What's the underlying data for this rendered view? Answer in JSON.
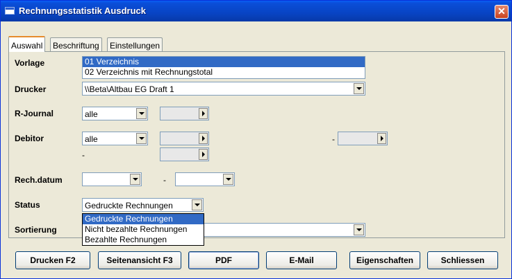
{
  "window": {
    "title": "Rechnungsstatistik Ausdruck",
    "close_label": "✕"
  },
  "tabs": [
    "Auswahl",
    "Beschriftung",
    "Einstellungen"
  ],
  "form": {
    "vorlage": {
      "label": "Vorlage",
      "items": [
        "01 Verzeichnis",
        "02 Verzeichnis mit Rechnungstotal"
      ],
      "selected_index": 0
    },
    "drucker": {
      "label": "Drucker",
      "value": "\\\\Beta\\Altbau EG Draft 1"
    },
    "rjournal": {
      "label": "R-Journal",
      "value": "alle"
    },
    "debitor": {
      "label": "Debitor",
      "value": "alle",
      "range_dash": "-",
      "below_dash": "-"
    },
    "rechdatum": {
      "label": "Rech.datum",
      "dash": "-"
    },
    "status": {
      "label": "Status",
      "value": "Gedruckte Rechnungen",
      "options": [
        "Gedruckte Rechnungen",
        "Nicht bezahlte Rechnungen",
        "Bezahlte Rechnungen"
      ],
      "highlighted_index": 0
    },
    "sortierung": {
      "label": "Sortierung"
    }
  },
  "buttons": {
    "drucken": "Drucken F2",
    "seitenansicht": "Seitenansicht F3",
    "pdf": "PDF",
    "email": "E-Mail",
    "eigenschaften": "Eigenschaften",
    "schliessen": "Schliessen"
  }
}
